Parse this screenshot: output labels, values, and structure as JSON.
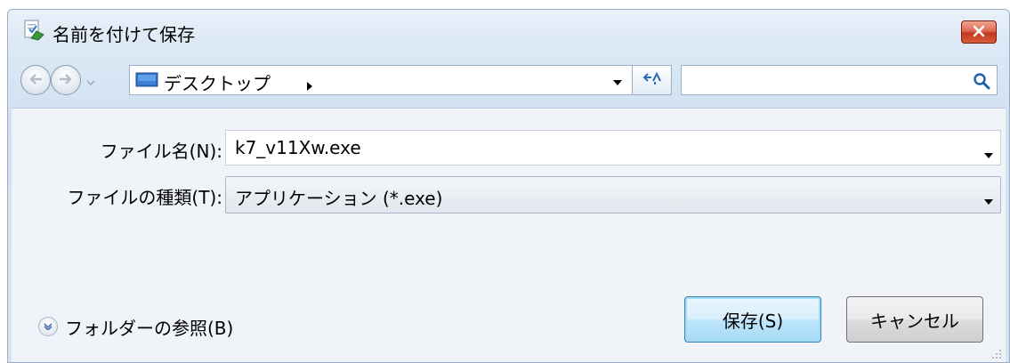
{
  "window": {
    "title": "名前を付けて保存",
    "title_icon": "save-as-icon",
    "close_icon": "close-icon"
  },
  "navigation": {
    "back_icon": "back-arrow-icon",
    "forward_icon": "forward-arrow-icon",
    "history_icon": "chevron-down-icon",
    "address": {
      "location_icon": "desktop-icon",
      "path": "デスクトップ",
      "separator_icon": "breadcrumb-arrow-icon",
      "dropdown_icon": "chevron-down-icon"
    },
    "refresh_icon": "refresh-icon",
    "search": {
      "placeholder": "",
      "icon": "search-icon"
    }
  },
  "form": {
    "filename_label": "ファイル名(N):",
    "filename_value": "k7_v11Xw.exe",
    "filetype_label": "ファイルの種類(T):",
    "filetype_value": "アプリケーション (*.exe)"
  },
  "footer": {
    "browse_folders_label": "フォルダーの参照(B)",
    "browse_icon": "expand-circle-icon",
    "save_label": "保存(S)",
    "cancel_label": "キャンセル"
  },
  "colors": {
    "title_bar": "#dce8f5",
    "close_button": "#c4391e",
    "panel": "#f0f4f9",
    "save_button_border": "#3c7fb1"
  }
}
